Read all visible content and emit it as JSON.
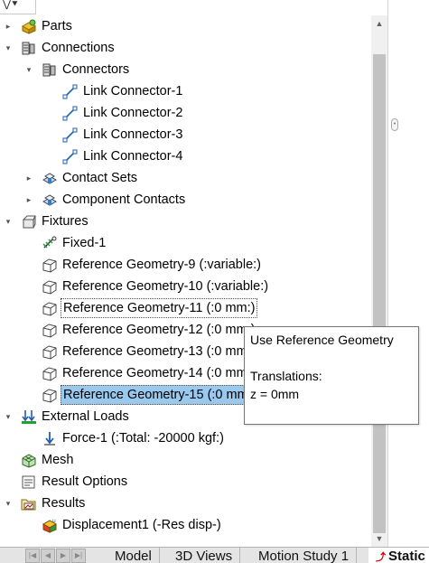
{
  "tree": [
    {
      "label": "Parts",
      "icon": "parts-icon",
      "toggle": "collapsed",
      "depth": 0
    },
    {
      "label": "Connections",
      "icon": "connections-icon",
      "toggle": "expanded",
      "depth": 0
    },
    {
      "label": "Connectors",
      "icon": "connectors-icon",
      "toggle": "expanded",
      "depth": 1
    },
    {
      "label": "Link Connector-1",
      "icon": "link-connector-icon",
      "toggle": "none",
      "depth": 2
    },
    {
      "label": "Link Connector-2",
      "icon": "link-connector-icon",
      "toggle": "none",
      "depth": 2
    },
    {
      "label": "Link Connector-3",
      "icon": "link-connector-icon",
      "toggle": "none",
      "depth": 2
    },
    {
      "label": "Link Connector-4",
      "icon": "link-connector-icon",
      "toggle": "none",
      "depth": 2
    },
    {
      "label": "Contact Sets",
      "icon": "contact-sets-icon",
      "toggle": "collapsed",
      "depth": 1
    },
    {
      "label": "Component Contacts",
      "icon": "component-contacts-icon",
      "toggle": "collapsed",
      "depth": 1
    },
    {
      "label": "Fixtures",
      "icon": "fixtures-icon",
      "toggle": "expanded",
      "depth": 0
    },
    {
      "label": "Fixed-1",
      "icon": "fixed-geometry-icon",
      "toggle": "none",
      "depth": 1
    },
    {
      "label": "Reference Geometry-9 (:variable:)",
      "icon": "reference-geometry-icon",
      "toggle": "none",
      "depth": 1
    },
    {
      "label": "Reference Geometry-10 (:variable:)",
      "icon": "reference-geometry-icon",
      "toggle": "none",
      "depth": 1
    },
    {
      "label": "Reference Geometry-11 (:0 mm:)",
      "icon": "reference-geometry-icon",
      "toggle": "none",
      "depth": 1,
      "state": "hover"
    },
    {
      "label": "Reference Geometry-12 (:0 mm:)",
      "icon": "reference-geometry-icon",
      "toggle": "none",
      "depth": 1
    },
    {
      "label": "Reference Geometry-13 (:0 mm:)",
      "icon": "reference-geometry-icon",
      "toggle": "none",
      "depth": 1
    },
    {
      "label": "Reference Geometry-14 (:0 mm:)",
      "icon": "reference-geometry-icon",
      "toggle": "none",
      "depth": 1
    },
    {
      "label": "Reference Geometry-15 (:0 mm:)",
      "icon": "reference-geometry-icon",
      "toggle": "none",
      "depth": 1,
      "state": "selected"
    },
    {
      "label": "External Loads",
      "icon": "external-loads-icon",
      "toggle": "expanded",
      "depth": 0
    },
    {
      "label": "Force-1 (:Total: -20000 kgf:)",
      "icon": "force-arrow-icon",
      "toggle": "none",
      "depth": 1
    },
    {
      "label": "Mesh",
      "icon": "mesh-icon",
      "toggle": "none",
      "depth": 0
    },
    {
      "label": "Result Options",
      "icon": "result-options-icon",
      "toggle": "none",
      "depth": 0
    },
    {
      "label": "Results",
      "icon": "results-folder-icon",
      "toggle": "expanded",
      "depth": 0
    },
    {
      "label": "Displacement1 (-Res disp-)",
      "icon": "displacement-plot-icon",
      "toggle": "none",
      "depth": 1
    }
  ],
  "tooltip": {
    "title": "Use Reference Geometry",
    "heading": "Translations:",
    "value": "z = 0mm"
  },
  "tabs": [
    {
      "label": "Model",
      "active": false
    },
    {
      "label": "3D Views",
      "active": false
    },
    {
      "label": "Motion Study 1",
      "active": false
    },
    {
      "label": "Static",
      "active": true
    }
  ],
  "colors": {
    "selection": "#99c9ef",
    "scroll_thumb": "#c2c2c2",
    "tab_bar": "#e4e4e4"
  }
}
